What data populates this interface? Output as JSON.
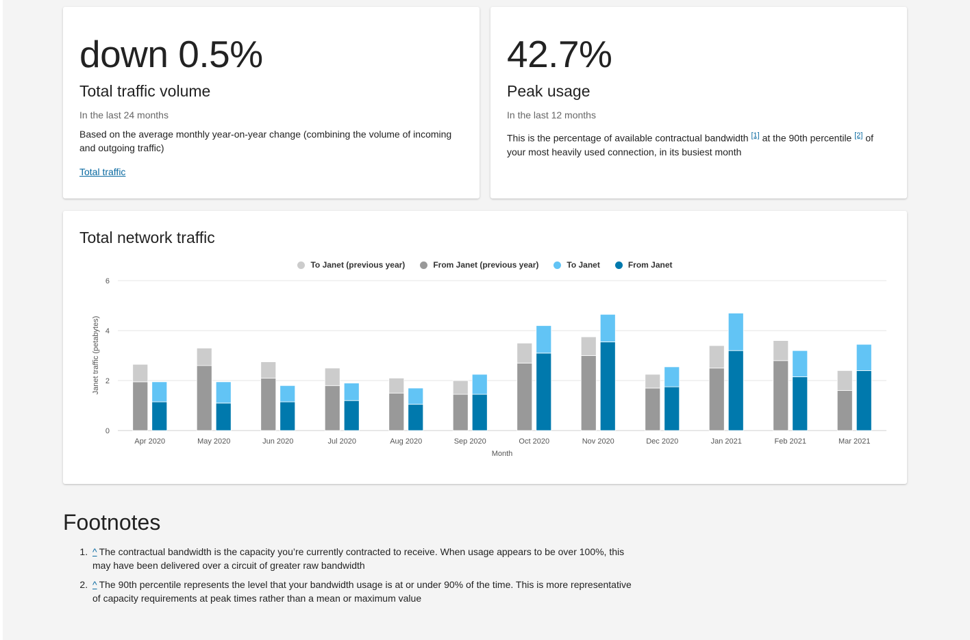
{
  "volume": {
    "big_value": "down 0.5%",
    "title": "Total traffic volume",
    "period": "In the last 24 months",
    "description": "Based on the average monthly year-on-year change (combining the volume of incoming and outgoing traffic)",
    "link_label": "Total traffic"
  },
  "peak": {
    "big_value": "42.7%",
    "title": "Peak usage",
    "period": "In the last 12 months",
    "desc_part1": "This is the percentage of available contractual bandwidth ",
    "ref1": "[1]",
    "desc_part2": " at the 90th percentile ",
    "ref2": "[2]",
    "desc_part3": " of your most heavily used connection, in its busiest month"
  },
  "chart_section": {
    "title": "Total network traffic"
  },
  "chart_data": {
    "type": "bar",
    "xlabel": "Month",
    "ylabel": "Janet traffic (petabytes)",
    "ylim": [
      0,
      6
    ],
    "yticks": [
      0,
      2,
      4,
      6
    ],
    "grid": true,
    "legend_position": "top-center",
    "categories": [
      "Apr 2020",
      "May 2020",
      "Jun 2020",
      "Jul 2020",
      "Aug 2020",
      "Sep 2020",
      "Oct 2020",
      "Nov 2020",
      "Dec 2020",
      "Jan 2021",
      "Feb 2021",
      "Mar 2021"
    ],
    "series": [
      {
        "name": "To Janet (previous year)",
        "color": "#cccccc",
        "stack": "previous",
        "values": [
          0.7,
          0.7,
          0.65,
          0.7,
          0.6,
          0.55,
          0.8,
          0.75,
          0.55,
          0.9,
          0.8,
          0.8
        ]
      },
      {
        "name": "From Janet (previous year)",
        "color": "#999999",
        "stack": "previous",
        "values": [
          1.95,
          2.6,
          2.1,
          1.8,
          1.5,
          1.45,
          2.7,
          3.0,
          1.7,
          2.5,
          2.8,
          1.6
        ]
      },
      {
        "name": "To Janet",
        "color": "#62c4f5",
        "stack": "current",
        "values": [
          0.8,
          0.85,
          0.65,
          0.7,
          0.65,
          0.8,
          1.1,
          1.1,
          0.8,
          1.5,
          1.05,
          1.05
        ]
      },
      {
        "name": "From Janet",
        "color": "#0079ad",
        "stack": "current",
        "values": [
          1.15,
          1.1,
          1.15,
          1.2,
          1.05,
          1.45,
          3.1,
          3.55,
          1.75,
          3.2,
          2.15,
          2.4
        ]
      }
    ]
  },
  "footnotes": {
    "title": "Footnotes",
    "caret": "^",
    "items": [
      "The contractual bandwidth is the capacity you’re currently contracted to receive. When usage appears to be over 100%, this may have been delivered over a circuit of greater raw bandwidth",
      "The 90th percentile represents the level that your bandwidth usage is at or under 90% of the time. This is more representative of capacity requirements at peak times rather than a mean or maximum value"
    ]
  }
}
